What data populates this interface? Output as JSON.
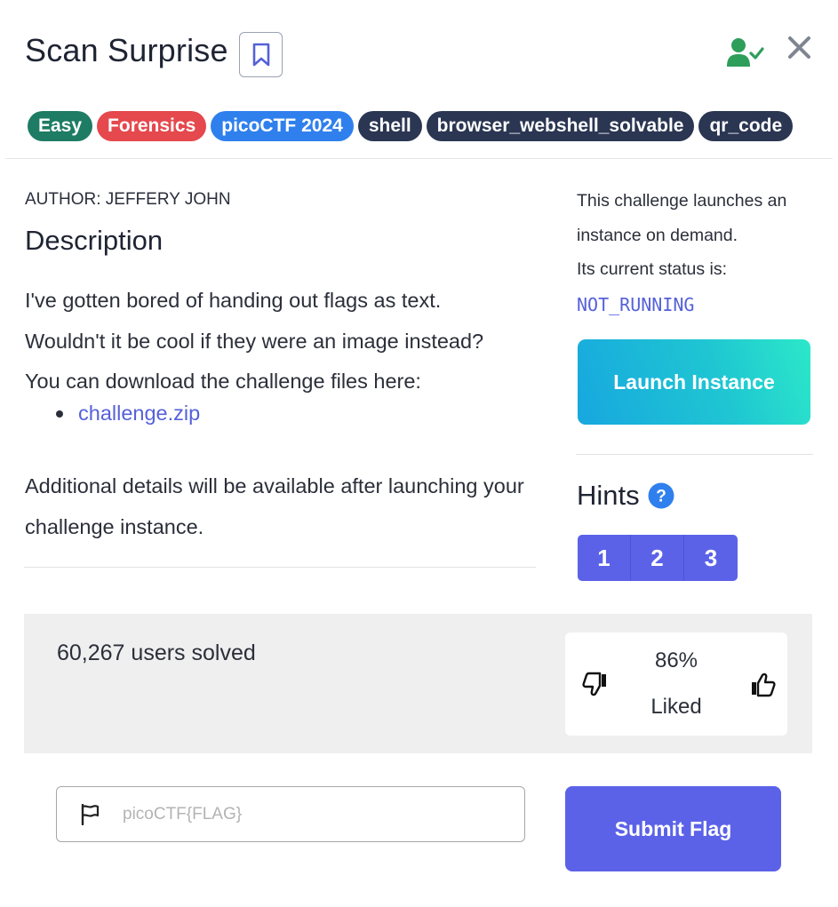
{
  "challenge": {
    "title": "Scan Surprise",
    "tags": [
      {
        "label": "Easy",
        "color": "#1e7b64"
      },
      {
        "label": "Forensics",
        "color": "#e5484d"
      },
      {
        "label": "picoCTF 2024",
        "color": "#2f80ed"
      },
      {
        "label": "shell",
        "color": "#2a3652"
      },
      {
        "label": "browser_webshell_solvable",
        "color": "#2a3652"
      },
      {
        "label": "qr_code",
        "color": "#2a3652"
      }
    ],
    "author": "AUTHOR: JEFFERY JOHN",
    "description_heading": "Description",
    "description_lines": [
      "I've gotten bored of handing out flags as text.",
      "Wouldn't it be cool if they were an image instead?",
      "You can download the challenge files here:"
    ],
    "file_link": "challenge.zip",
    "additional_details": "Additional details will be available after launching your challenge instance."
  },
  "instance": {
    "info_line1": "This challenge launches an instance on demand.",
    "info_line2": "Its current status is:",
    "status": "NOT_RUNNING",
    "launch_label": "Launch Instance"
  },
  "hints": {
    "heading": "Hints",
    "buttons": [
      "1",
      "2",
      "3"
    ]
  },
  "stats": {
    "solved": "60,267 users solved",
    "liked_percent": "86%",
    "liked_label": "Liked"
  },
  "flag": {
    "placeholder": "picoCTF{FLAG}",
    "value": "",
    "submit_label": "Submit Flag"
  },
  "icons": {
    "bookmark": "bookmark-icon",
    "user_solved": "user-check-icon",
    "close": "close-icon",
    "help": "question-circle-icon",
    "thumbs_down": "thumbs-down-icon",
    "thumbs_up": "thumbs-up-icon",
    "flag": "flag-icon"
  },
  "colors": {
    "accent": "#5b62e8",
    "link": "#5561d8",
    "success": "#2e9e5b",
    "launch_gradient_start": "#17a7df",
    "launch_gradient_end": "#2ce8c9"
  }
}
